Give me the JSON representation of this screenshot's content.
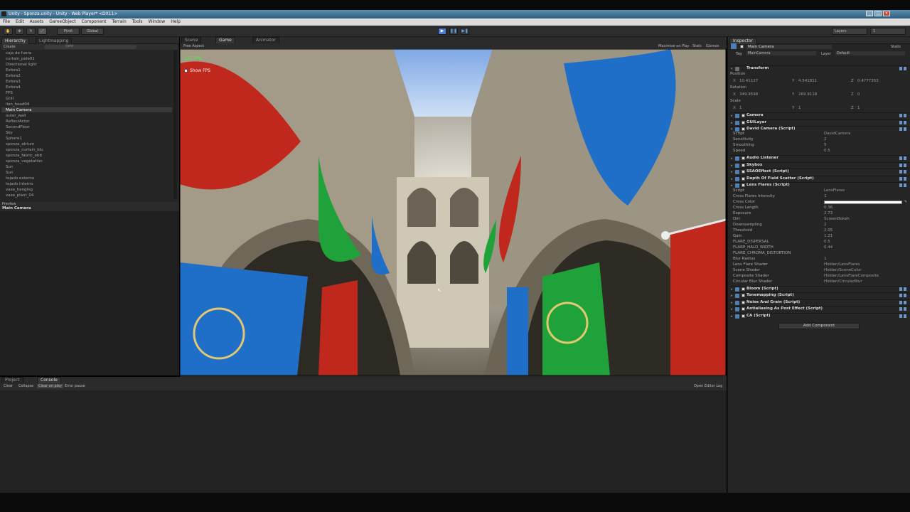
{
  "window": {
    "title": "Unity - Sponza.unity - Unity - Web Player* <DX11>",
    "buttons": [
      "_",
      "□",
      "×"
    ]
  },
  "menu": [
    "File",
    "Edit",
    "Assets",
    "GameObject",
    "Component",
    "Terrain",
    "Tools",
    "Window",
    "Help"
  ],
  "toolbar": {
    "pivot_label": "Pivot",
    "global_label": "Global",
    "layers_label": "Layers",
    "layout_label": "1"
  },
  "hierarchy": {
    "tabs": [
      "Hierarchy",
      "Lightmapping"
    ],
    "create_label": "Create",
    "search_placeholder": "Q▾All",
    "items": [
      "caja de fuera",
      "curtain_pole01",
      "Directional light",
      "Esfera1",
      "Esfera2",
      "Esfera3",
      "Esfera4",
      "FPS",
      "Grill",
      "lion_head04",
      "Main Camera",
      "outer_wall",
      "ReflectActor",
      "SecondFloor",
      "Sky",
      "Sphere1",
      "sponza_atrium",
      "sponza_curtain_blu",
      "sponza_fabric_ebb",
      "sponza_vegetation",
      "Sun",
      "Sun",
      "tejado externo",
      "tejado interno",
      "vase_hanging",
      "vase_plant_04"
    ],
    "selected": "Main Camera",
    "preview_label": "Preview",
    "preview_object": "Main Camera"
  },
  "center": {
    "tabs": [
      "Scene",
      "Game",
      "Animator"
    ],
    "aspect": "Free Aspect",
    "options": [
      "Maximize on Play",
      "Stats",
      "Gizmos"
    ],
    "fps_overlay": "237 FPS",
    "showfps": "Show FPS"
  },
  "inspector": {
    "tab": "Inspector",
    "object_name": "Main Camera",
    "static_label": "Static",
    "tag_label": "Tag",
    "tag_value": "MainCamera",
    "layer_label": "Layer",
    "layer_value": "Default",
    "transform": {
      "title": "Transform",
      "position_label": "Position",
      "position": [
        "10.41127",
        "4.541811",
        "0.4777353"
      ],
      "rotation_label": "Rotation",
      "rotation": [
        "349.9598",
        "269.9118",
        "0"
      ],
      "scale_label": "Scale",
      "scale": [
        "1",
        "1",
        "1"
      ],
      "axes": [
        "X",
        "Y",
        "Z"
      ]
    },
    "components": [
      {
        "name": "Camera"
      },
      {
        "name": "GUILayer"
      },
      {
        "name": "David Camera (Script)"
      }
    ],
    "david_props": [
      {
        "label": "Script",
        "value": "DavidCamera"
      },
      {
        "label": "Sensitivity",
        "value": "2"
      },
      {
        "label": "Smoothing",
        "value": "5"
      },
      {
        "label": "Speed",
        "value": "0.5"
      }
    ],
    "components2": [
      {
        "name": "Audio Listener"
      },
      {
        "name": "Skybox"
      },
      {
        "name": "SSAOEffect (Script)"
      },
      {
        "name": "Depth Of Field Scatter (Script)"
      },
      {
        "name": "Lens Flares (Script)"
      }
    ],
    "lens_props": [
      {
        "label": "Script",
        "value": "LensFlares"
      },
      {
        "label": "Cross Flares Intensity",
        "value": "1"
      },
      {
        "label": "Cross Color",
        "value": ""
      },
      {
        "label": "Cross Length",
        "value": "0.36"
      },
      {
        "label": "Exposure",
        "value": "2.73"
      },
      {
        "label": "Dirt",
        "value": "ScreenBokeh"
      },
      {
        "label": "Downsampling",
        "value": "2"
      },
      {
        "label": "Threshold",
        "value": "2.05"
      },
      {
        "label": "Gain",
        "value": "1.21"
      },
      {
        "label": "FLARE_DISPERSAL",
        "value": "0.5"
      },
      {
        "label": "FLARE_HALO_WIDTH",
        "value": "0.44"
      },
      {
        "label": "FLARE_CHROMA_DISTORTION",
        "value": ""
      },
      {
        "label": "Blur Radius",
        "value": "1"
      },
      {
        "label": "Lens Flare Shader",
        "value": "Hidden/LensFlares"
      },
      {
        "label": "Scene Shader",
        "value": "Hidden/SceneColor"
      },
      {
        "label": "Composite Shader",
        "value": "Hidden/LensFlareComposite"
      },
      {
        "label": "Circular Blur Shader",
        "value": "Hidden/CircularBlur"
      }
    ],
    "components3": [
      {
        "name": "Bloom (Script)"
      },
      {
        "name": "Tonemapping (Script)"
      },
      {
        "name": "Noise And Grain (Script)"
      },
      {
        "name": "Antialiasing As Post Effect (Script)"
      },
      {
        "name": "CA (Script)"
      }
    ],
    "add_component": "Add Component"
  },
  "bottom": {
    "tabs": [
      "Project",
      "Console"
    ],
    "console_buttons": [
      "Clear",
      "Collapse",
      "Clear on play",
      "Error pause"
    ],
    "open_editor_log": "Open Editor Log"
  },
  "colors": {
    "panel_bg": "#252525",
    "accent_blue": "#4a7ad0",
    "banner_red": "#c0281e",
    "banner_green": "#1fa23a",
    "banner_blue": "#1f6fc9"
  }
}
